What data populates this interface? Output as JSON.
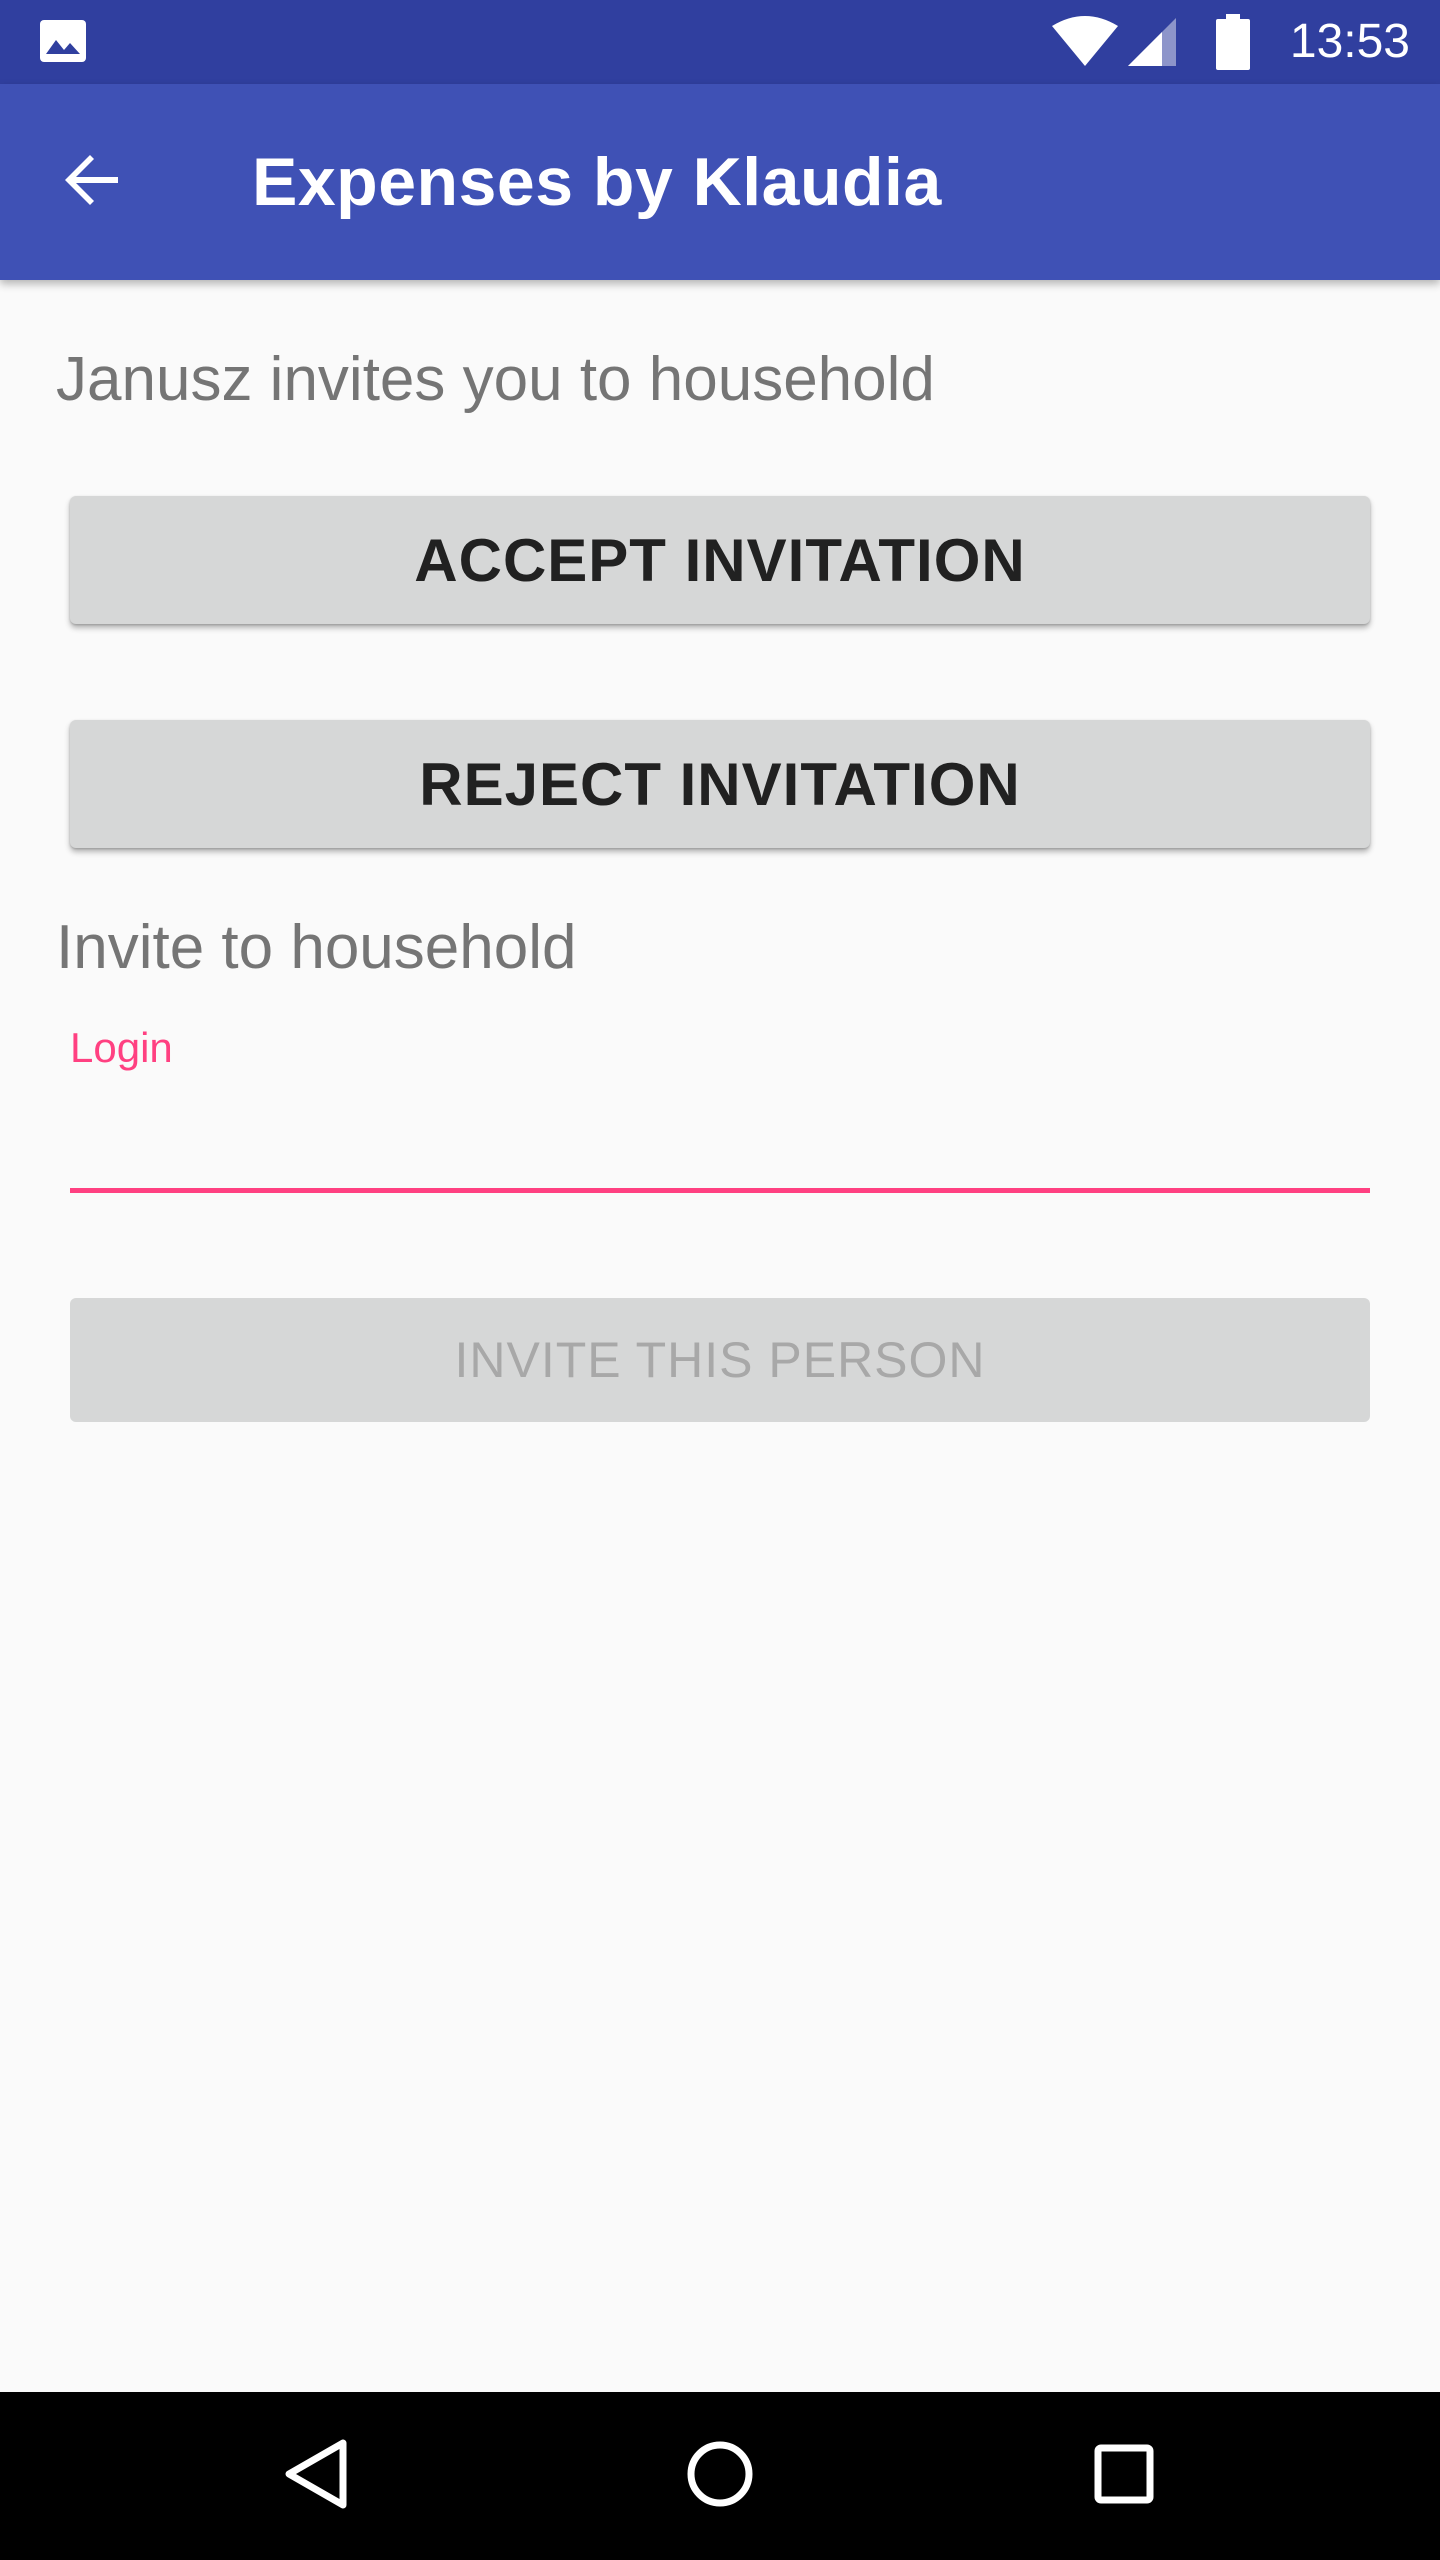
{
  "status_bar": {
    "time": "13:53",
    "icons": [
      "picture-notification-icon",
      "wifi-icon",
      "cell-signal-icon",
      "battery-icon"
    ]
  },
  "app_bar": {
    "title": "Expenses by Klaudia",
    "back_icon": "arrow-back-icon"
  },
  "invitation": {
    "message": "Janusz invites you to household",
    "accept_label": "ACCEPT INVITATION",
    "reject_label": "REJECT INVITATION"
  },
  "invite_section": {
    "heading": "Invite to household",
    "login_label": "Login",
    "login_value": "",
    "invite_button_label": "INVITE THIS PERSON"
  },
  "nav_bar": {
    "icons": [
      "nav-back-icon",
      "nav-home-icon",
      "nav-recents-icon"
    ]
  },
  "colors": {
    "status_bar": "#303f9f",
    "app_bar": "#3f51b5",
    "accent": "#ff4081",
    "button": "#d6d7d7",
    "background": "#fafafa"
  }
}
